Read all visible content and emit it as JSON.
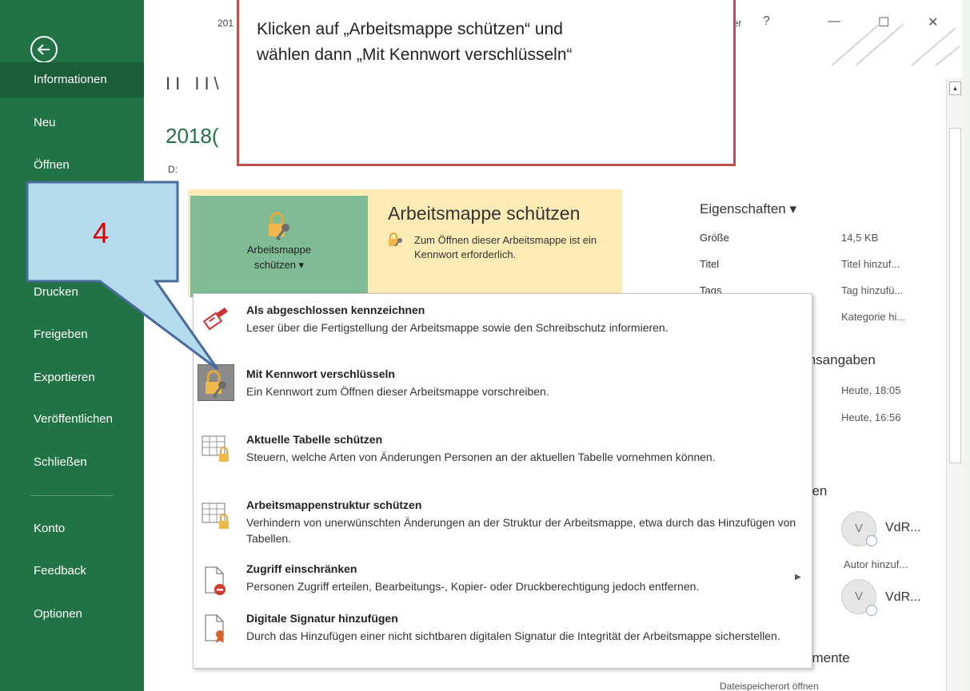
{
  "sidebar": {
    "items": [
      {
        "label": "Informationen"
      },
      {
        "label": "Neu"
      },
      {
        "label": "Öffnen"
      },
      {
        "label": "Drucken"
      },
      {
        "label": "Freigeben"
      },
      {
        "label": "Exportieren"
      },
      {
        "label": "Veröffentlichen"
      },
      {
        "label": "Schließen"
      },
      {
        "label": "Konto"
      },
      {
        "label": "Feedback"
      },
      {
        "label": "Optionen"
      }
    ]
  },
  "titlebar": {
    "title_partial": "201",
    "signin_partial": "erer",
    "help": "?",
    "minimize": "—",
    "maximize": "☐",
    "close": "✕"
  },
  "document": {
    "heading_partial": "II II\\",
    "title_partial": "2018(",
    "path": "D:"
  },
  "protect": {
    "button_label_line1": "Arbeitsmappe",
    "button_label_line2": "schützen ▾",
    "title": "Arbeitsmappe schützen",
    "description": "Zum Öffnen dieser Arbeitsmappe ist ein Kennwort erforderlich."
  },
  "properties": {
    "title": "Eigenschaften ▾",
    "rows": [
      {
        "label": "Größe",
        "value": "14,5 KB"
      },
      {
        "label": "Titel",
        "value": "Titel hinzuf..."
      },
      {
        "label": "Tags",
        "value": "Tag hinzufü..."
      },
      {
        "label": "",
        "value": "Kategorie hi..."
      }
    ],
    "dates_heading_partial": "msangaben",
    "dates": [
      "Heute, 18:05",
      "Heute, 16:56"
    ],
    "persons_heading_partial": "nen",
    "author_initial": "V",
    "author_name": "VdR...",
    "add_author": "Autor hinzuf...",
    "last_modified_partial": "n",
    "author2_initial": "V",
    "author2_name": "VdR...",
    "docs_heading_partial": "umente",
    "open_location_partial": "Dateispeicherort öffnen"
  },
  "menu": {
    "items": [
      {
        "title": "Als abgeschlossen kennzeichnen",
        "desc": "Leser über die Fertigstellung der Arbeitsmappe sowie den Schreibschutz informieren."
      },
      {
        "title": "Mit Kennwort verschlüsseln",
        "desc": "Ein Kennwort zum Öffnen dieser Arbeitsmappe vorschreiben."
      },
      {
        "title": "Aktuelle Tabelle schützen",
        "desc": "Steuern, welche Arten von Änderungen Personen an der aktuellen Tabelle vornehmen können."
      },
      {
        "title": "Arbeitsmappenstruktur schützen",
        "desc": "Verhindern von unerwünschten Änderungen an der Struktur der Arbeitsmappe, etwa durch das Hinzufügen von Tabellen."
      },
      {
        "title": "Zugriff einschränken",
        "desc": "Personen Zugriff erteilen, Bearbeitungs-, Kopier- oder Druckberechtigung jedoch entfernen."
      },
      {
        "title": "Digitale Signatur hinzufügen",
        "desc": "Durch das Hinzufügen einer nicht sichtbaren digitalen Signatur die Integrität der Arbeitsmappe sicherstellen."
      }
    ],
    "submenu_arrow": "▶"
  },
  "callouts": {
    "instruction_line1": "Klicken auf „Arbeitsmappe schützen“ und",
    "instruction_line2": "wählen dann „Mit Kennwort verschlüsseln“",
    "step_number": "4"
  },
  "colors": {
    "sidebar": "#217346",
    "sidebar_active": "#1a5c37",
    "protect_band": "#fcebb4",
    "protect_button": "#7fbc96",
    "callout_border_red": "#c0504d",
    "callout_blue_fill": "#b4dcec",
    "callout_blue_border": "#4a6a9b",
    "step_number": "#e00000"
  }
}
